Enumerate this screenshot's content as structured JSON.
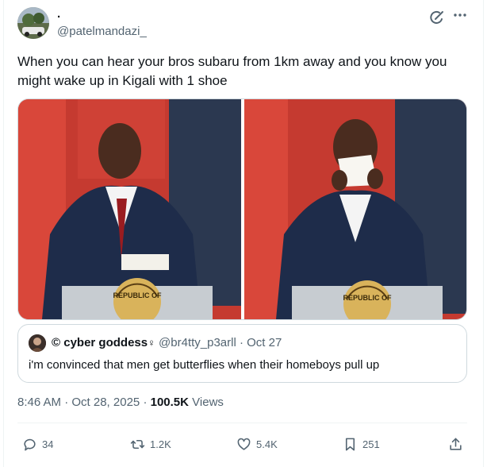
{
  "tweet": {
    "display_name": ".",
    "handle": "@patelmandazi_",
    "text": "When you can hear your bros subaru from 1km away and you know you might wake up in Kigali with 1 shoe",
    "seal_text": "REPUBLIC OF",
    "timestamp": "8:46 AM · Oct 28, 2025",
    "views_count": "100.5K",
    "views_label": "Views"
  },
  "quote": {
    "name": "cyber goddess",
    "handle_date": "@br4tty_p3arll · Oct 27",
    "text": "i'm convinced that men get butterflies when their homeboys pull up"
  },
  "actions": {
    "replies": "34",
    "reposts": "1.2K",
    "likes": "5.4K",
    "bookmarks": "251"
  },
  "colors": {
    "text": "#0f1419",
    "secondary": "#536471",
    "border": "#cfd9de"
  },
  "icons": [
    "grok-icon",
    "more-icon",
    "reply-icon",
    "repost-icon",
    "like-icon",
    "bookmark-icon",
    "share-icon"
  ]
}
